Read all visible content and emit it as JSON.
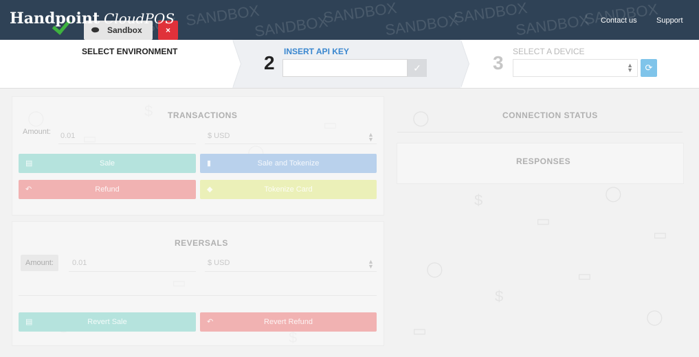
{
  "header": {
    "brand": "Handpoint",
    "brand_sub": "CloudPOS",
    "watermark": "SANDBOX",
    "links": [
      "Contact us",
      "Support"
    ]
  },
  "steps": {
    "step1": {
      "title": "SELECT ENVIRONMENT",
      "env_label": "Sandbox",
      "env_icon": "link-icon",
      "remove_icon": "×"
    },
    "step2": {
      "number": "2",
      "title": "INSERT API KEY",
      "input_value": "",
      "confirm_icon": "check-icon"
    },
    "step3": {
      "number": "3",
      "title": "SELECT A DEVICE",
      "select_value": "",
      "refresh_icon": "refresh-icon"
    }
  },
  "transactions": {
    "title": "TRANSACTIONS",
    "amount_label": "Amount:",
    "amount_value": "0.01",
    "currency": "$ USD",
    "buttons": [
      {
        "label": "Sale",
        "icon": "card-icon",
        "color": "#b5e3dd"
      },
      {
        "label": "Sale and Tokenize",
        "icon": "bookmark-icon",
        "color": "#b9d1ec"
      },
      {
        "label": "Refund",
        "icon": "undo-icon",
        "color": "#f1b2b2"
      },
      {
        "label": "Tokenize Card",
        "icon": "tag-icon",
        "color": "#ebf0b8"
      }
    ]
  },
  "connection": {
    "title": "CONNECTION STATUS"
  },
  "responses": {
    "title": "RESPONSES"
  },
  "reversals": {
    "title": "REVERSALS",
    "amount_label": "Amount:",
    "amount_value": "0.01",
    "currency": "$ USD",
    "buttons": [
      {
        "label": "Revert Sale",
        "icon": "card-icon",
        "color": "#b5e3dd"
      },
      {
        "label": "Revert Refund",
        "icon": "undo-icon",
        "color": "#f1b2b2"
      }
    ]
  },
  "colors": {
    "header_bg": "#2f4256",
    "step_active": "#3a87cf",
    "step_inactive": "#b0b0b0",
    "success": "#3fb33f",
    "danger": "#e0313a",
    "refresh": "#7fc4ea"
  }
}
